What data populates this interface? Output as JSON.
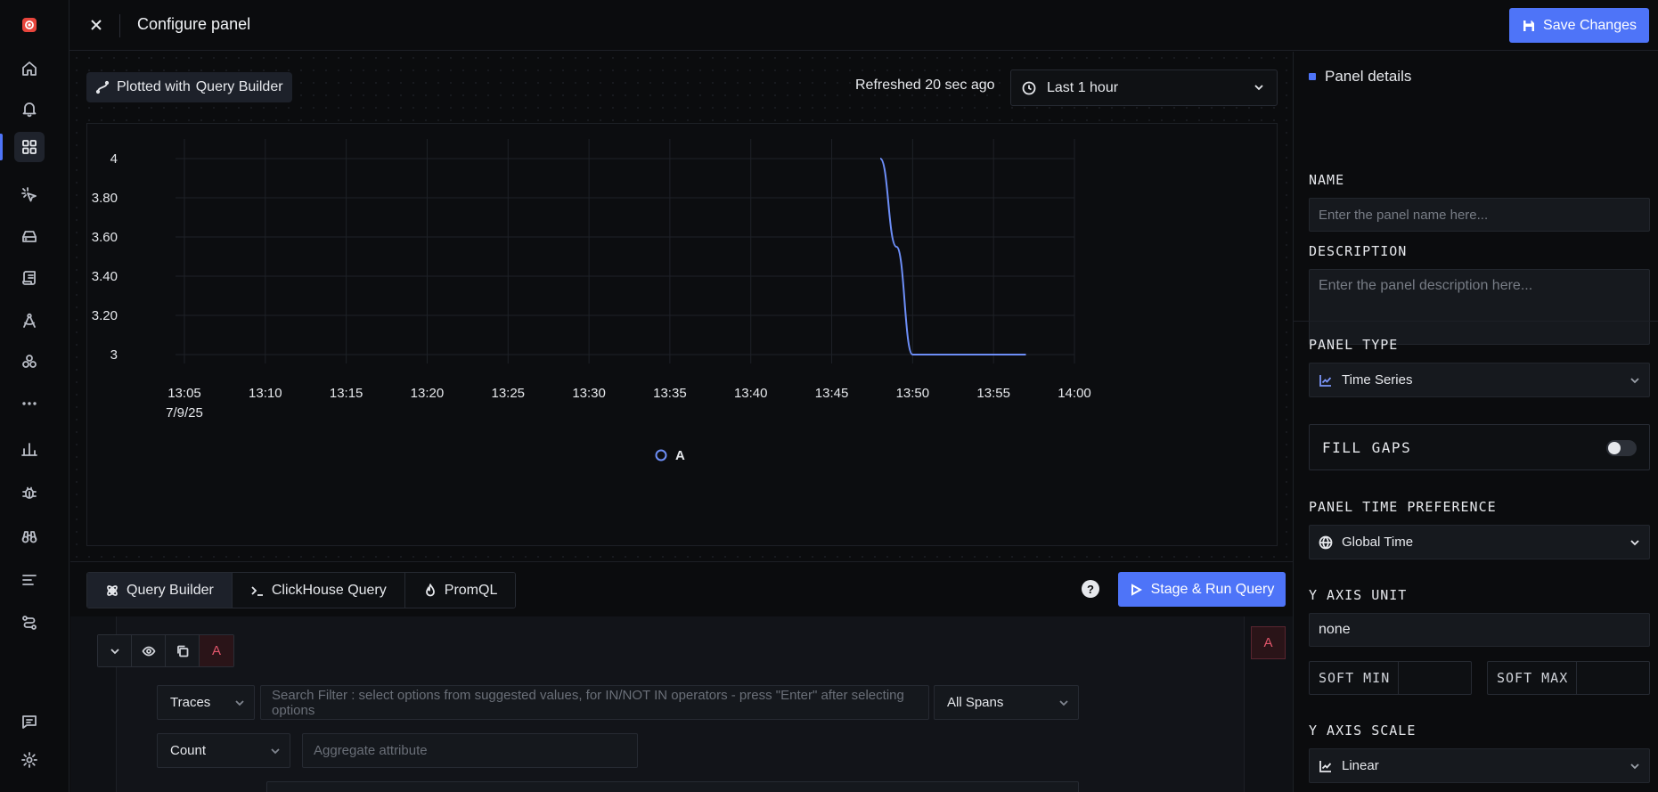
{
  "topbar": {
    "title": "Configure panel",
    "save_label": "Save Changes"
  },
  "preview": {
    "plotted_with_prefix": "Plotted with",
    "plotted_with_value": "Query Builder",
    "refreshed": "Refreshed 20 sec ago",
    "time_range": "Last 1 hour"
  },
  "chart_data": {
    "type": "line",
    "x_ticks": [
      "13:05",
      "13:10",
      "13:15",
      "13:20",
      "13:25",
      "13:30",
      "13:35",
      "13:40",
      "13:45",
      "13:50",
      "13:55",
      "14:00"
    ],
    "x_date_label": "7/9/25",
    "y_ticks": [
      "3",
      "3.20",
      "3.40",
      "3.60",
      "3.80",
      "4"
    ],
    "ylim": [
      3,
      4
    ],
    "series": [
      {
        "name": "A",
        "color": "#6d8ef7",
        "points": [
          {
            "x": "13:48",
            "y": 4
          },
          {
            "x": "13:49",
            "y": 3.55
          },
          {
            "x": "13:50",
            "y": 3
          },
          {
            "x": "13:51",
            "y": 3
          },
          {
            "x": "13:52",
            "y": 3
          },
          {
            "x": "13:53",
            "y": 3
          },
          {
            "x": "13:54",
            "y": 3
          },
          {
            "x": "13:55",
            "y": 3
          },
          {
            "x": "13:56",
            "y": 3
          },
          {
            "x": "13:57",
            "y": 3
          }
        ]
      }
    ],
    "grid": true,
    "legend_position": "bottom-center"
  },
  "query_tabs": {
    "items": [
      {
        "label": "Query Builder"
      },
      {
        "label": "ClickHouse Query"
      },
      {
        "label": "PromQL"
      }
    ],
    "help": "?",
    "run_label": "Stage & Run Query"
  },
  "query_builder": {
    "query_letter": "A",
    "data_source": "Traces",
    "search_placeholder": "Search Filter : select options from suggested values, for IN/NOT IN operators - press \"Enter\" after selecting options",
    "span_scope": "All Spans",
    "aggregate_op": "Count",
    "aggregate_placeholder": "Aggregate attribute"
  },
  "panel": {
    "header": "Panel details",
    "name_label": "NAME",
    "name_placeholder": "Enter the panel name here...",
    "description_label": "DESCRIPTION",
    "description_placeholder": "Enter the panel description here...",
    "panel_type_label": "PANEL TYPE",
    "panel_type": "Time Series",
    "fill_gaps_label": "FILL GAPS",
    "fill_gaps_on": false,
    "time_pref_label": "PANEL TIME PREFERENCE",
    "time_pref": "Global Time",
    "y_unit_label": "Y AXIS UNIT",
    "y_unit": "none",
    "soft_min_label": "SOFT MIN",
    "soft_max_label": "SOFT MAX",
    "y_scale_label": "Y AXIS SCALE",
    "y_scale": "Linear"
  },
  "colors": {
    "accent": "#4e74f8",
    "series": "#6d8ef7",
    "query_letter": "#e1566b"
  }
}
